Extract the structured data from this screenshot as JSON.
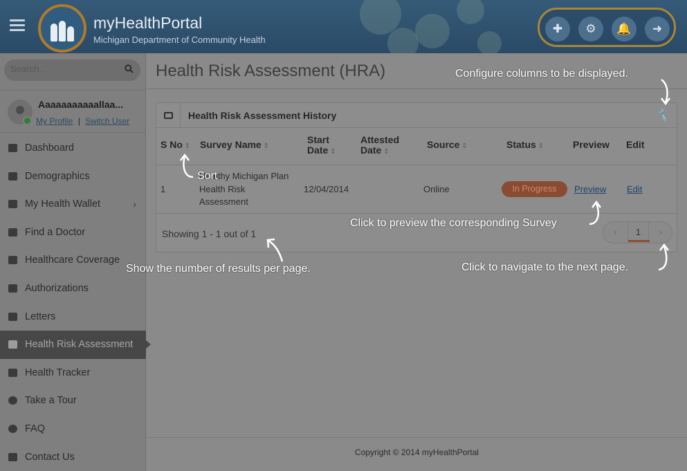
{
  "header": {
    "brand_title": "myHealthPortal",
    "brand_subtitle": "Michigan Department of Community Health",
    "actions": [
      {
        "name": "add-user-icon",
        "glyph": "✚"
      },
      {
        "name": "settings-icon",
        "glyph": "⚙"
      },
      {
        "name": "bell-icon",
        "glyph": "🔔"
      },
      {
        "name": "logout-icon",
        "glyph": "➜"
      }
    ]
  },
  "sidebar": {
    "search_placeholder": "Search...",
    "user": {
      "name": "Aaaaaaaaaaallaa...",
      "profile_link": "My Profile",
      "separator": "|",
      "switch_link": "Switch User"
    },
    "items": [
      {
        "label": "Dashboard"
      },
      {
        "label": "Demographics"
      },
      {
        "label": "My Health Wallet",
        "chevron": "›"
      },
      {
        "label": "Find a Doctor"
      },
      {
        "label": "Healthcare Coverage"
      },
      {
        "label": "Authorizations"
      },
      {
        "label": "Letters"
      },
      {
        "label": "Health Risk Assessment",
        "active": true
      },
      {
        "label": "Health Tracker"
      },
      {
        "label": "Take a Tour"
      },
      {
        "label": "FAQ"
      },
      {
        "label": "Contact Us"
      }
    ]
  },
  "main": {
    "page_title": "Health Risk Assessment (HRA)",
    "panel_title": "Health Risk Assessment History",
    "columns": {
      "sno": "S No",
      "survey": "Survey Name",
      "start1": "Start",
      "start2": "Date",
      "attested1": "Attested",
      "attested2": "Date",
      "source": "Source",
      "status": "Status",
      "preview": "Preview",
      "edit": "Edit"
    },
    "rows": [
      {
        "sno": "1",
        "survey_line1": "Healthy Michigan Plan",
        "survey_line2": "Health Risk",
        "survey_line3": "Assessment",
        "start_date": "12/04/2014",
        "attested_date": "",
        "source": "Online",
        "status": "In Progress",
        "preview": "Preview",
        "edit": "Edit"
      }
    ],
    "showing": "Showing 1 - 1 out of 1",
    "pager": {
      "prev": "‹",
      "current": "1",
      "next": "›"
    }
  },
  "footer": {
    "text": "Copyright © 2014 myHealthPortal"
  },
  "annotations": {
    "configure": "Configure columns to be displayed.",
    "sort": "Sort",
    "preview": "Click to preview the corresponding Survey",
    "results": "Show the number of results per page.",
    "next": "Click to navigate to the next page."
  },
  "colors": {
    "header": "#2a4a66",
    "accent_gold": "#a98735",
    "status_badge": "#8a4b33",
    "overlay_gray": "#8a8a8a"
  }
}
